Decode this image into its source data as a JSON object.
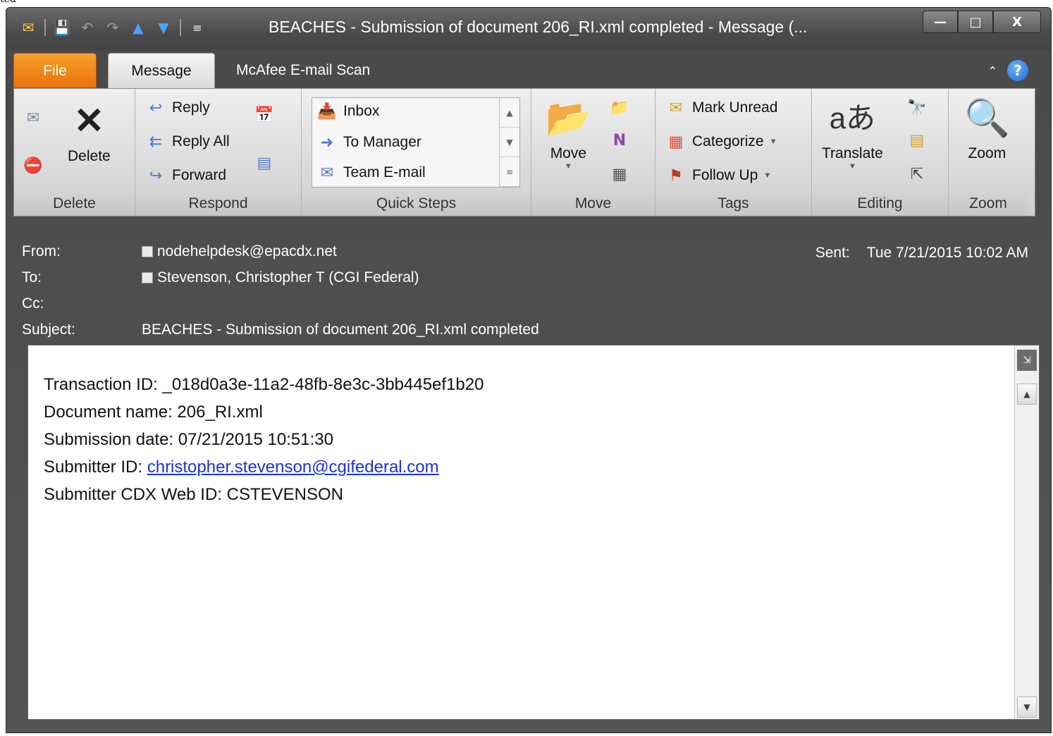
{
  "page_fragment": "ted",
  "window": {
    "title": "BEACHES - Submission of document 206_RI.xml completed  -  Message (...",
    "qat_icons": [
      "mail-icon",
      "save-icon",
      "undo-icon",
      "redo-icon",
      "up-arrow-icon",
      "down-arrow-icon",
      "customize-qat-icon"
    ],
    "controls": {
      "minimize": "—",
      "maximize": "□",
      "close": "X"
    }
  },
  "tabs": [
    {
      "label": "File"
    },
    {
      "label": "Message"
    },
    {
      "label": "McAfee E-mail Scan"
    }
  ],
  "ribbon": {
    "delete_group": {
      "label": "Delete",
      "delete_button": "Delete"
    },
    "respond_group": {
      "label": "Respond",
      "reply": "Reply",
      "reply_all": "Reply All",
      "forward": "Forward"
    },
    "quick_steps_group": {
      "label": "Quick Steps",
      "items": [
        "Inbox",
        "To Manager",
        "Team E-mail"
      ]
    },
    "move_group": {
      "label": "Move",
      "move_button": "Move"
    },
    "tags_group": {
      "label": "Tags",
      "mark_unread": "Mark Unread",
      "categorize": "Categorize",
      "follow_up": "Follow Up"
    },
    "editing_group": {
      "label": "Editing",
      "translate": "Translate"
    },
    "zoom_group": {
      "label": "Zoom",
      "zoom_button": "Zoom"
    }
  },
  "header": {
    "from_label": "From:",
    "from_value": "nodehelpdesk@epacdx.net",
    "to_label": "To:",
    "to_value": "Stevenson, Christopher T (CGI Federal)",
    "cc_label": "Cc:",
    "cc_value": "",
    "subject_label": "Subject:",
    "subject_value": "BEACHES - Submission of document 206_RI.xml completed",
    "sent_label": "Sent:",
    "sent_value": "Tue 7/21/2015 10:02 AM"
  },
  "body": {
    "transaction_id": "Transaction ID: _018d0a3e-11a2-48fb-8e3c-3bb445ef1b20",
    "document_name": "Document name: 206_RI.xml",
    "submission_date": "Submission date: 07/21/2015 10:51:30",
    "submitter_id_label": "Submitter ID: ",
    "submitter_id_link": "christopher.stevenson@cgifederal.com",
    "submitter_cdx": "Submitter CDX Web ID: CSTEVENSON"
  }
}
